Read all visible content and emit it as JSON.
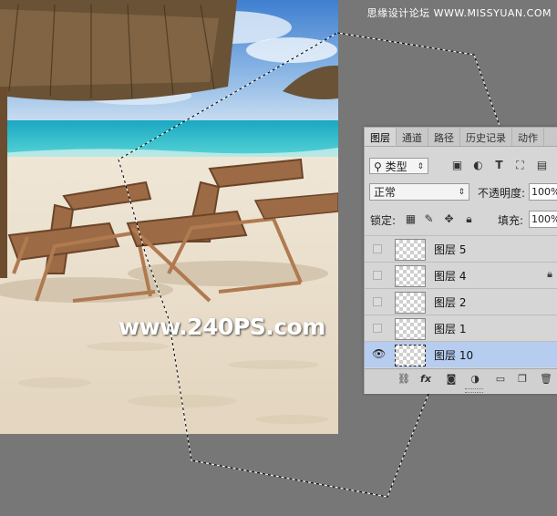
{
  "watermark_top": "思缘设计论坛 WWW.MISSYUAN.COM",
  "site_watermark": "www.240PS.com",
  "panel": {
    "tabs": [
      "图层",
      "通道",
      "路径",
      "历史记录",
      "动作"
    ],
    "filter_kind": "类型",
    "blend_mode": "正常",
    "opacity_label": "不透明度:",
    "opacity_value": "100%",
    "lock_label": "锁定:",
    "fill_label": "填充:",
    "fill_value": "100%",
    "layers": [
      {
        "name": "图层 5",
        "visible": false,
        "locked": false,
        "selected": false
      },
      {
        "name": "图层 4",
        "visible": false,
        "locked": true,
        "selected": false
      },
      {
        "name": "图层 2",
        "visible": false,
        "locked": false,
        "selected": false
      },
      {
        "name": "图层 1",
        "visible": false,
        "locked": false,
        "selected": false
      },
      {
        "name": "图层 10",
        "visible": true,
        "locked": false,
        "selected": true
      }
    ]
  },
  "colors": {
    "workspace": "#777777",
    "panel_bg": "#d6d6d6",
    "selected_layer": "#b7cdf0"
  }
}
